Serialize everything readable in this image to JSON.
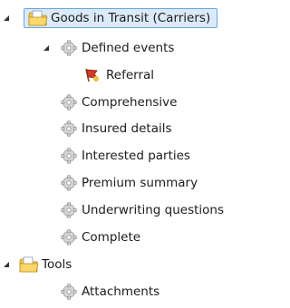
{
  "tree": {
    "items": [
      {
        "label": "Goods in Transit (Carriers)",
        "icon": "folder-document-icon",
        "expanded": true,
        "selected": true
      },
      {
        "label": "Defined events",
        "icon": "gear-cog-icon",
        "expanded": true
      },
      {
        "label": "Referral",
        "icon": "referral-flag-icon"
      },
      {
        "label": "Comprehensive",
        "icon": "gear-cog-icon"
      },
      {
        "label": "Insured details",
        "icon": "gear-cog-icon"
      },
      {
        "label": "Interested parties",
        "icon": "gear-cog-icon"
      },
      {
        "label": "Premium summary",
        "icon": "gear-cog-icon"
      },
      {
        "label": "Underwriting questions",
        "icon": "gear-cog-icon"
      },
      {
        "label": "Complete",
        "icon": "gear-cog-icon"
      },
      {
        "label": "Tools",
        "icon": "folder-document-icon",
        "expanded": true
      },
      {
        "label": "Attachments",
        "icon": "gear-cog-icon"
      }
    ]
  }
}
